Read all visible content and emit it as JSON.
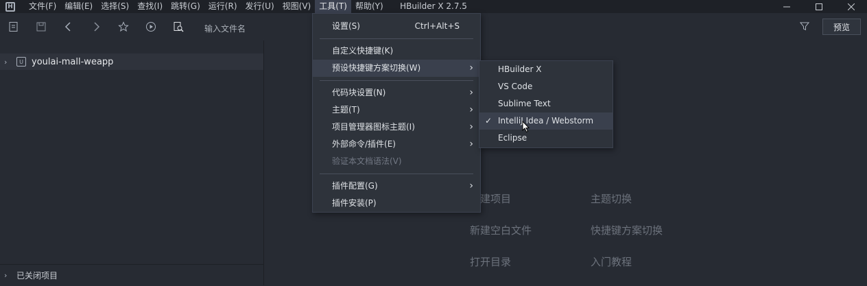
{
  "window": {
    "title": "HBuilder X 2.7.5"
  },
  "menubar": [
    {
      "label": "文件(F)"
    },
    {
      "label": "编辑(E)"
    },
    {
      "label": "选择(S)"
    },
    {
      "label": "查找(I)"
    },
    {
      "label": "跳转(G)"
    },
    {
      "label": "运行(R)"
    },
    {
      "label": "发行(U)"
    },
    {
      "label": "视图(V)"
    },
    {
      "label": "工具(T)"
    },
    {
      "label": "帮助(Y)"
    }
  ],
  "toolbar": {
    "file_search_placeholder": "输入文件名",
    "preview_label": "预览"
  },
  "sidebar": {
    "project_name": "youlai-mall-weapp",
    "closed_projects_label": "已关闭项目"
  },
  "tools_menu": {
    "items": [
      {
        "label": "设置(S)",
        "shortcut": "Ctrl+Alt+S"
      },
      {
        "label": "自定义快捷键(K)"
      },
      {
        "label": "预设快捷键方案切换(W)"
      },
      {
        "label": "代码块设置(N)"
      },
      {
        "label": "主题(T)"
      },
      {
        "label": "项目管理器图标主题(I)"
      },
      {
        "label": "外部命令/插件(E)"
      },
      {
        "label": "验证本文档语法(V)"
      },
      {
        "label": "插件配置(G)"
      },
      {
        "label": "插件安装(P)"
      }
    ]
  },
  "keymap_submenu": {
    "items": [
      {
        "label": "HBuilder X"
      },
      {
        "label": "VS Code"
      },
      {
        "label": "Sublime Text"
      },
      {
        "label": "IntelliJ Idea / Webstorm",
        "checked": true
      },
      {
        "label": "Eclipse"
      }
    ]
  },
  "welcome": {
    "new_project": "新建项目",
    "theme_switch": "主题切换",
    "new_blank_file": "新建空白文件",
    "keymap_switch": "快捷键方案切换",
    "open_directory": "打开目录",
    "getting_started": "入门教程"
  }
}
